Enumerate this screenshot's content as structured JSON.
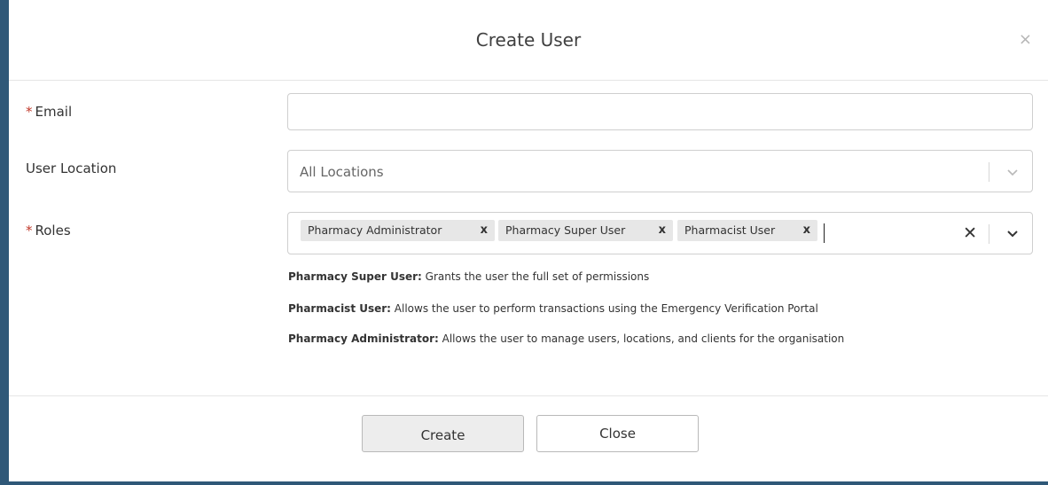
{
  "dialog": {
    "title": "Create User",
    "close_glyph": "×"
  },
  "form": {
    "email": {
      "label": "Email",
      "required_mark": "*",
      "value": "",
      "placeholder": ""
    },
    "user_location": {
      "label": "User Location",
      "value": "All Locations"
    },
    "roles": {
      "label": "Roles",
      "required_mark": "*",
      "selected": [
        {
          "label": "Pharmacy Administrator",
          "remove": "x"
        },
        {
          "label": "Pharmacy Super User",
          "remove": "x"
        },
        {
          "label": "Pharmacist User",
          "remove": "x"
        }
      ],
      "clear_glyph": "✕"
    },
    "role_descriptions": [
      {
        "role": "Pharmacy Super User:",
        "text": " Grants the user the full set of permissions"
      },
      {
        "role": "Pharmacist User:",
        "text": " Allows the user to perform transactions using the Emergency Verification Portal"
      },
      {
        "role": "Pharmacy Administrator:",
        "text": " Allows the user to manage users, locations, and clients for the organisation"
      }
    ]
  },
  "footer": {
    "create_label": "Create",
    "close_label": "Close"
  },
  "icons": {
    "dialog_close": "close-icon",
    "dropdown": "chevron-down-icon",
    "clear": "clear-icon"
  },
  "colors": {
    "required": "#c0392b",
    "backdrop": "#2f5878",
    "chip_bg": "#e7e7e7"
  }
}
